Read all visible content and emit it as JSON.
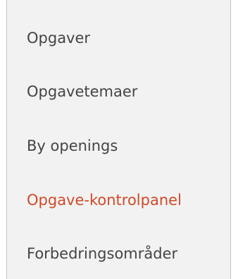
{
  "menu": {
    "items": [
      {
        "label": "Opgaver",
        "active": false
      },
      {
        "label": "Opgavetemaer",
        "active": false
      },
      {
        "label": "By openings",
        "active": false
      },
      {
        "label": "Opgave-kontrolpanel",
        "active": true
      },
      {
        "label": "Forbedringsområder",
        "active": false
      }
    ],
    "colors": {
      "background": "#f2f2f2",
      "border": "#b8c6d6",
      "text": "#444444",
      "active_text": "#cf4a28"
    }
  }
}
